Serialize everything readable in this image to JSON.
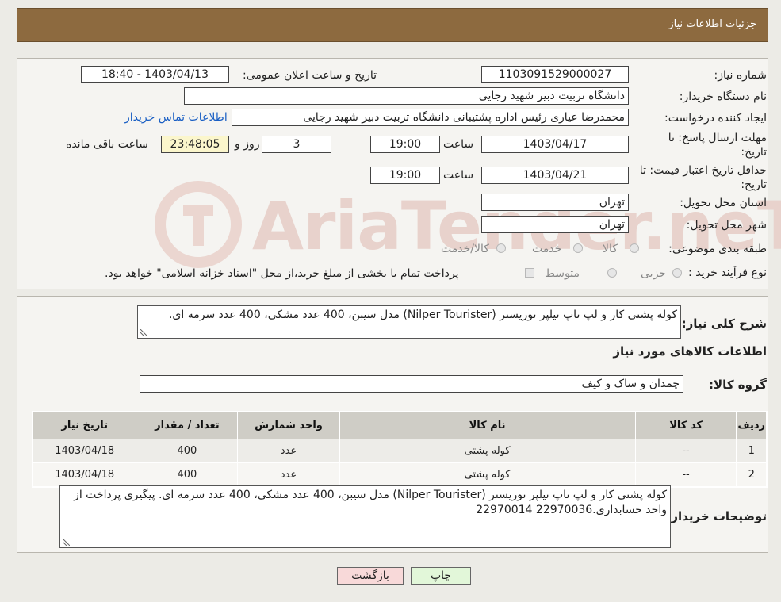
{
  "header": {
    "title": "جزئیات اطلاعات نیاز"
  },
  "watermark": "AriaTender.neT",
  "info": {
    "need_number_label": "شماره نیاز:",
    "need_number": "1103091529000027",
    "announce_label": "تاریخ و ساعت اعلان عمومی:",
    "announce_value": "1403/04/13 - 18:40",
    "buyer_org_label": "نام دستگاه خریدار:",
    "buyer_org": "دانشگاه تربیت دبیر شهید رجایی",
    "creator_label": "ایجاد کننده درخواست:",
    "creator": "محمدرضا عیاری رئیس اداره پشتیبانی دانشگاه تربیت دبیر شهید رجایی",
    "contact_link": "اطلاعات تماس خریدار",
    "deadline_label_1": "مهلت ارسال پاسخ: تا",
    "deadline_label_2": "تاریخ:",
    "deadline_date": "1403/04/17",
    "time_label": "ساعت",
    "deadline_time": "19:00",
    "days_value": "3",
    "days_label": "روز و",
    "remaining_time": "23:48:05",
    "remaining_label": "ساعت باقی مانده",
    "validity_label_1": "حداقل تاریخ اعتبار قیمت: تا",
    "validity_label_2": "تاریخ:",
    "validity_date": "1403/04/21",
    "validity_time": "19:00",
    "province_label": "استان محل تحویل:",
    "province": "تهران",
    "city_label": "شهر محل تحویل:",
    "city": "تهران",
    "category_label": "طبقه بندی موضوعی:",
    "category_options": [
      "کالا",
      "خدمت",
      "کالا/خدمت"
    ],
    "process_label": "نوع فرآیند خرید :",
    "process_options": [
      "جزیی",
      "متوسط"
    ],
    "process_note": "پرداخت تمام یا بخشی از مبلغ خرید،از محل \"اسناد خزانه اسلامی\" خواهد بود."
  },
  "details": {
    "summary_label": "شرح کلی نیاز:",
    "summary": "کوله پشتی کار و لپ تاپ نیلپر توریستر (Nilper Tourister) مدل سیبن، 400 عدد مشکی، 400 عدد سرمه ای.",
    "goods_heading": "اطلاعات کالاهای مورد نیاز",
    "group_label": "گروه کالا:",
    "group_value": "چمدان و ساک و کیف",
    "table": {
      "headers": [
        "ردیف",
        "کد کالا",
        "نام کالا",
        "واحد شمارش",
        "تعداد / مقدار",
        "تاریخ نیاز"
      ],
      "rows": [
        [
          "1",
          "--",
          "کوله پشتی",
          "عدد",
          "400",
          "1403/04/18"
        ],
        [
          "2",
          "--",
          "کوله پشتی",
          "عدد",
          "400",
          "1403/04/18"
        ]
      ]
    },
    "buyer_notes_label": "توضیحات خریدار:",
    "buyer_notes": "کوله پشتی کار و لپ تاپ نیلپر توریستر (Nilper Tourister) مدل سیبن، 400 عدد مشکی، 400 عدد سرمه ای.  پیگیری پرداخت از واحد حسابداری.22970036 22970014"
  },
  "buttons": {
    "print": "چاپ",
    "back": "بازگشت"
  },
  "colors": {
    "header_bg": "#8d6a3f",
    "link": "#1a5fc4",
    "remaining_bg": "#fbf6cc",
    "back_bg": "#f8d9d9",
    "print_bg": "#e2f7d9"
  }
}
